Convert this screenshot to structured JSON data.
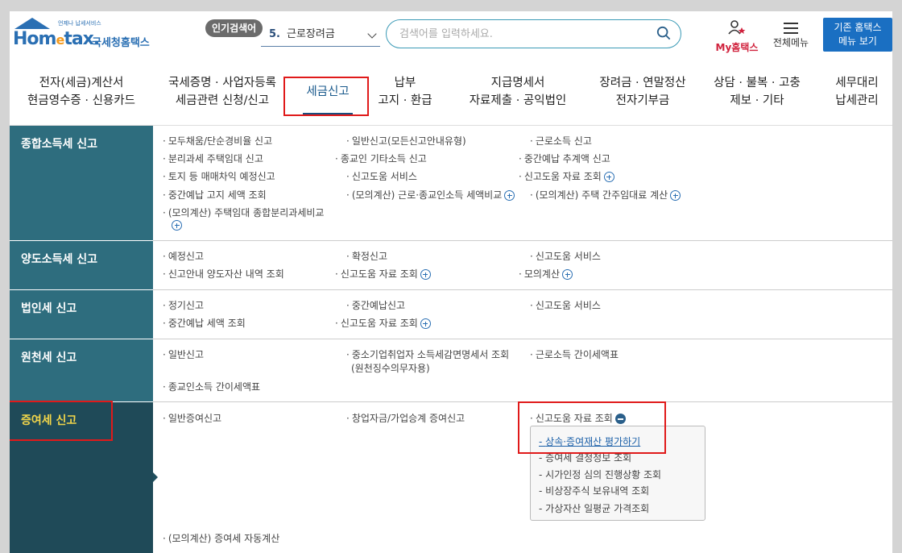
{
  "header": {
    "logo_main": "Hometax.",
    "logo_sub": "언제나 납세서비스",
    "logo_kr": "국세청홈택스",
    "popular_badge": "인기검색어",
    "popular_num": "5.",
    "popular_term": "근로장려금",
    "search_placeholder": "검색어를 입력하세요.",
    "my_label": "My홈택스",
    "allmenu_label": "전체메뉴",
    "oldmenu_line1": "기존 홈택스",
    "oldmenu_line2": "메뉴 보기"
  },
  "gnb": [
    {
      "l1": "전자(세금)계산서",
      "l2": "현금영수증 · 신용카드"
    },
    {
      "l1": "국세증명 · 사업자등록",
      "l2": "세금관련 신청/신고"
    },
    {
      "l1": "세금신고",
      "l2": ""
    },
    {
      "l1": "납부",
      "l2": "고지 · 환급"
    },
    {
      "l1": "지급명세서",
      "l2": "자료제출 · 공익법인"
    },
    {
      "l1": "장려금 · 연말정산",
      "l2": "전자기부금"
    },
    {
      "l1": "상담 · 불복 · 고충",
      "l2": "제보 · 기타"
    },
    {
      "l1": "세무대리",
      "l2": "납세관리"
    }
  ],
  "sections": [
    {
      "title": "종합소득세 신고",
      "links": [
        "모두채움/단순경비율 신고",
        "일반신고(모든신고안내유형)",
        "근로소득 신고",
        "분리과세 주택임대 신고",
        "종교인 기타소득 신고",
        "중간예납 추계액 신고",
        "토지 등 매매차익 예정신고",
        "신고도움 서비스",
        "신고도움 자료 조회",
        "중간예납 고지 세액 조회",
        "(모의계산) 근로·종교인소득 세액비교",
        "(모의계산) 주택 간주임대료 계산",
        "(모의계산) 주택임대 종합분리과세비교"
      ]
    },
    {
      "title": "양도소득세 신고",
      "links": [
        "예정신고",
        "확정신고",
        "신고도움 서비스",
        "신고안내 양도자산 내역 조회",
        "신고도움 자료 조회",
        "모의계산"
      ]
    },
    {
      "title": "법인세 신고",
      "links": [
        "정기신고",
        "중간예납신고",
        "신고도움 서비스",
        "중간예납 세액 조회",
        "신고도움 자료 조회"
      ]
    },
    {
      "title": "원천세 신고",
      "links": [
        "일반신고",
        "중소기업취업자 소득세감면명세서 조회",
        "(원천징수의무자용)",
        "근로소득 간이세액표",
        "종교인소득 간이세액표"
      ]
    },
    {
      "title": "증여세 신고",
      "links": [
        "일반증여신고",
        "창업자금/가업승계 증여신고",
        "신고도움 자료 조회",
        "(모의계산) 증여세 자동계산"
      ]
    }
  ],
  "dropdown": [
    "상속·증여재산 평가하기",
    "증여세 결정정보 조회",
    "시가인정 심의 진행상황 조회",
    "비상장주식 보유내역 조회",
    "가상자산 일평균 가격조회"
  ],
  "colors": {
    "sidebar_teal": "#2e6d7e",
    "sidebar_dark": "#1f4a58",
    "accent": "#1a6fc2",
    "highlight": "#e01a1a"
  }
}
